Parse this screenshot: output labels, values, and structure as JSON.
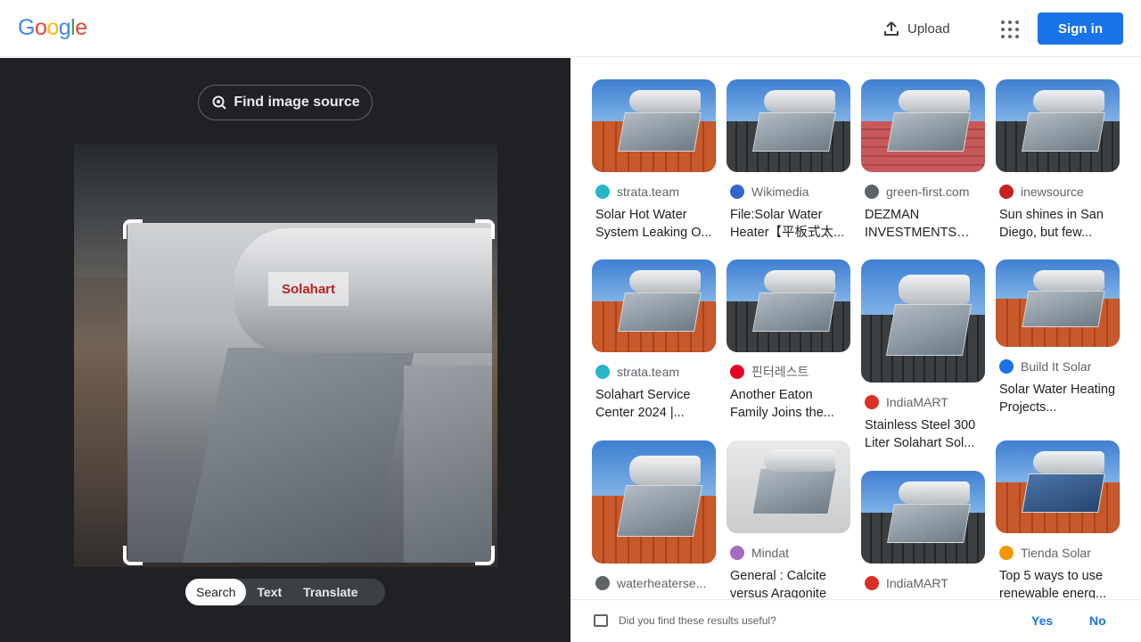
{
  "header": {
    "logo": [
      "G",
      "o",
      "o",
      "g",
      "l",
      "e"
    ],
    "upload_label": "Upload",
    "apps_icon": "apps-grid-icon",
    "signin_label": "Sign in"
  },
  "lens": {
    "find_source_label": "Find image source",
    "photo_brand_text": "Solahart",
    "modes": [
      {
        "label": "Search",
        "active": true
      },
      {
        "label": "Text",
        "active": false
      },
      {
        "label": "Translate",
        "active": false
      }
    ]
  },
  "results": [
    {
      "source": "strata.team",
      "favicon": "strata-favicon",
      "favicon_color": "#28b5c7",
      "title": "Solar Hot Water System Leaking O...",
      "style": "roof"
    },
    {
      "source": "Wikimedia",
      "favicon": "wikimedia-favicon",
      "favicon_color": "#3366cc",
      "title": "File:Solar Water Heater【平板式太...",
      "style": "dark"
    },
    {
      "source": "green-first.com",
      "favicon": "globe-favicon",
      "favicon_color": "#5f6368",
      "title": "DEZMAN INVESTMENTS CC...",
      "style": "red"
    },
    {
      "source": "inewsource",
      "favicon": "inewsource-favicon",
      "favicon_color": "#c5221f",
      "title": "Sun shines in San Diego, but few...",
      "style": "dark"
    },
    {
      "source": "strata.team",
      "favicon": "strata-favicon",
      "favicon_color": "#28b5c7",
      "title": "Solahart Service Center 2024 |...",
      "style": "roof"
    },
    {
      "source": "핀터레스트",
      "favicon": "pinterest-favicon",
      "favicon_color": "#e60023",
      "title": "Another Eaton Family Joins the...",
      "style": "dark"
    },
    {
      "source": "IndiaMART",
      "favicon": "indiamart-favicon",
      "favicon_color": "#d93025",
      "title": "Stainless Steel 300 Liter Solahart Sol...",
      "style": "dark"
    },
    {
      "source": "Build It Solar",
      "favicon": "builditsolar-favicon",
      "favicon_color": "#1a73e8",
      "title": "Solar Water Heating Projects...",
      "style": "roof"
    },
    {
      "source": "waterheaterse...",
      "favicon": "globe-favicon",
      "favicon_color": "#5f6368",
      "title": "",
      "style": "roof"
    },
    {
      "source": "Mindat",
      "favicon": "mindat-favicon",
      "favicon_color": "#a56cc1",
      "title": "General : Calcite versus Aragonite",
      "style": "plain"
    },
    {
      "source": "IndiaMART",
      "favicon": "indiamart-favicon",
      "favicon_color": "#d93025",
      "title": "",
      "style": "dark"
    },
    {
      "source": "Tienda Solar",
      "favicon": "tiendasolar-favicon",
      "favicon_color": "#f29900",
      "title": "Top 5 ways to use renewable energ...",
      "style": "blue"
    }
  ],
  "feedback": {
    "question": "Did you find these results useful?",
    "yes_label": "Yes",
    "no_label": "No"
  }
}
